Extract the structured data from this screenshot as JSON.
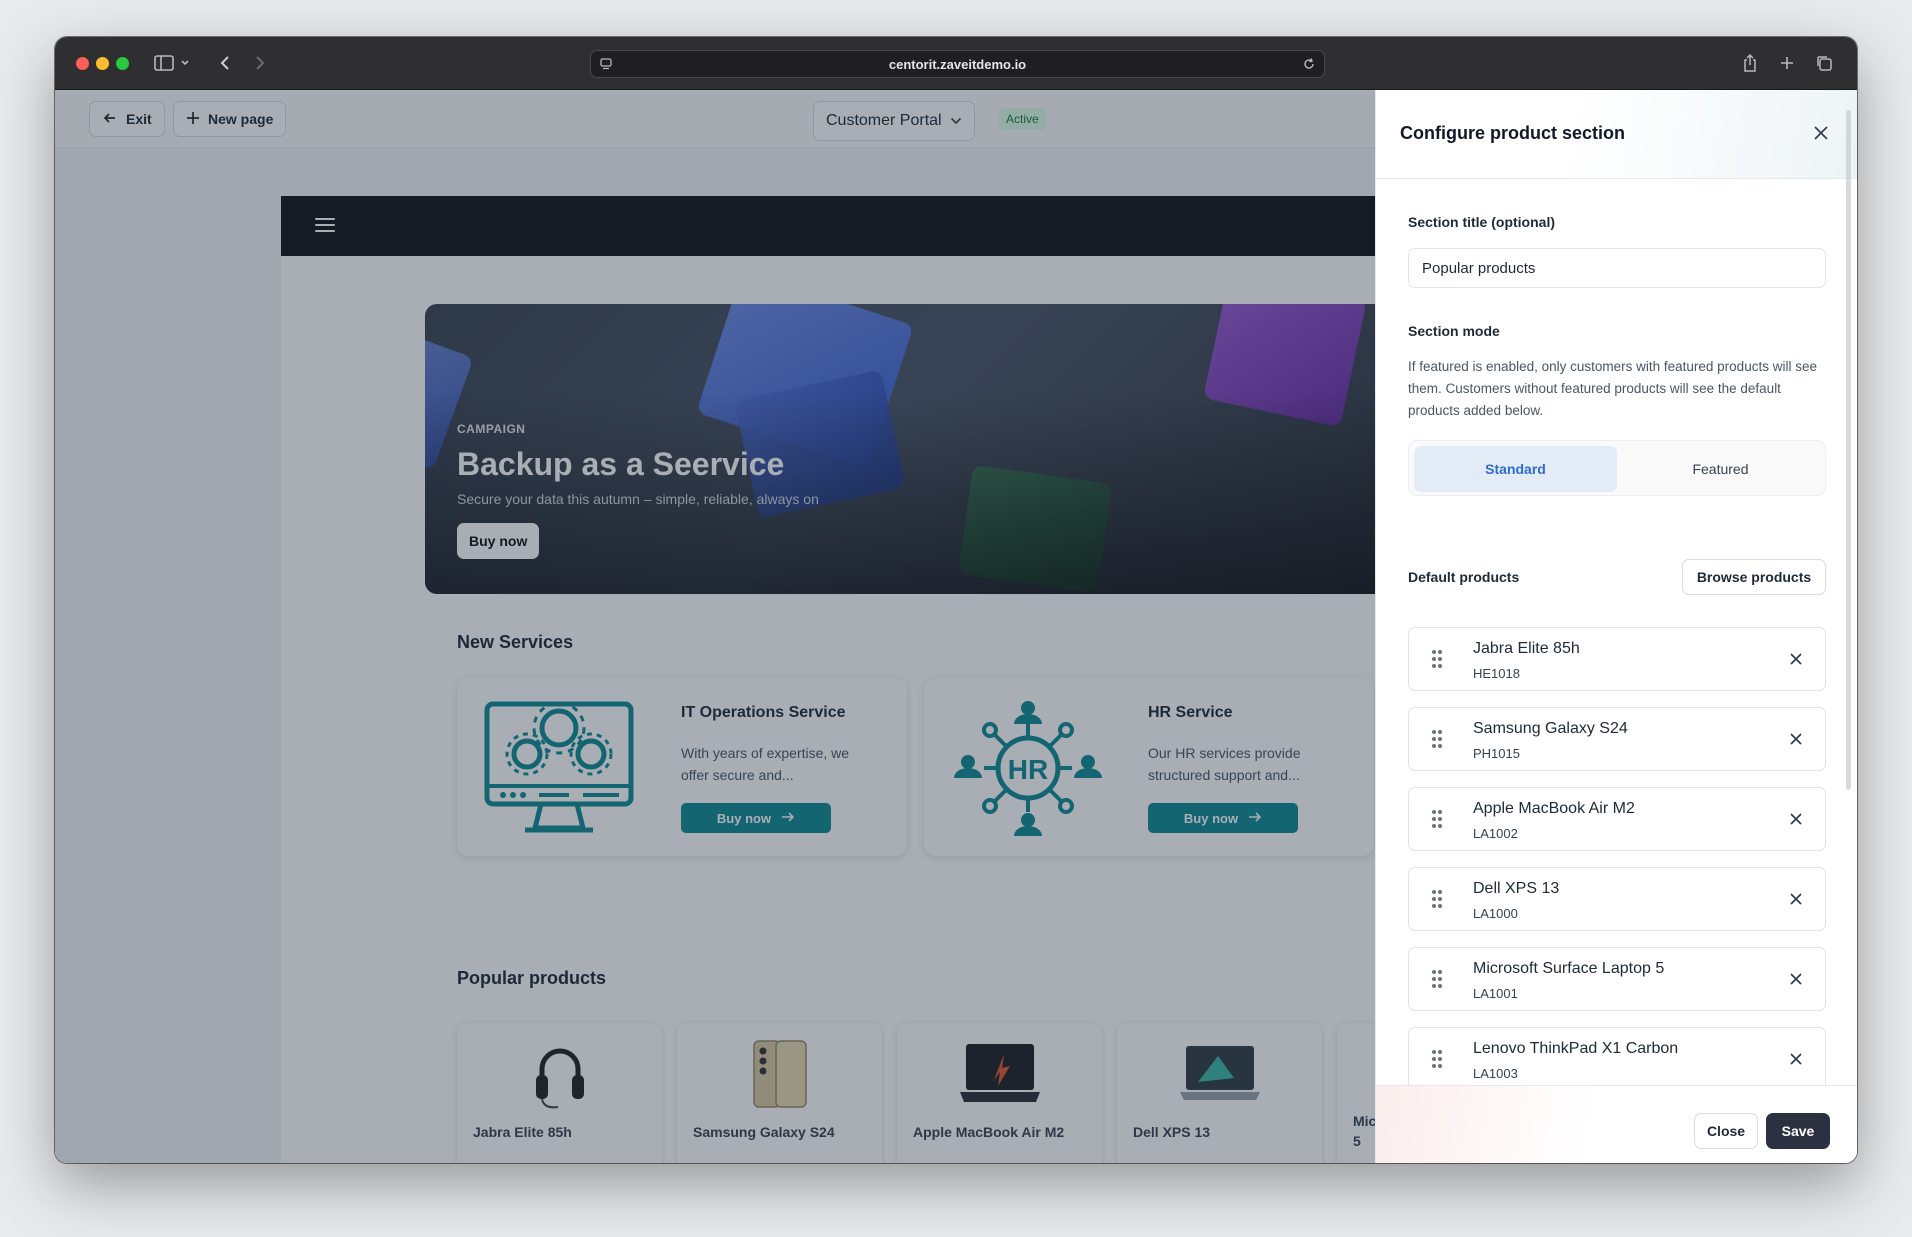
{
  "browser": {
    "url": "centorit.zaveitdemo.io"
  },
  "topbar": {
    "exit_label": "Exit",
    "new_page_label": "New page",
    "portal_name": "Customer Portal",
    "status_badge": "Active"
  },
  "hero": {
    "eyebrow": "CAMPAIGN",
    "title": "Backup as a Seervice",
    "subtitle": "Secure your data this autumn – simple, reliable, always on",
    "button_label": "Buy now"
  },
  "new_services": {
    "title": "New Services",
    "cards": [
      {
        "title": "IT Operations Service",
        "description": "With years of expertise, we offer secure and...",
        "button_label": "Buy now"
      },
      {
        "title": "HR Service",
        "description": "Our HR services provide structured support and...",
        "button_label": "Buy now"
      }
    ]
  },
  "popular_products": {
    "title": "Popular products",
    "cards": [
      {
        "name": "Jabra Elite 85h"
      },
      {
        "name": "Samsung Galaxy S24"
      },
      {
        "name": "Apple MacBook Air M2"
      },
      {
        "name": "Dell XPS 13"
      },
      {
        "name": "Mic"
      },
      {
        "name": "5"
      }
    ]
  },
  "drawer": {
    "title": "Configure product section",
    "section_title_label": "Section title (optional)",
    "section_title_value": "Popular products",
    "section_mode_label": "Section mode",
    "section_mode_description": "If featured is enabled, only customers with featured products will see them. Customers without featured products will see the default products added below.",
    "modes": [
      {
        "label": "Standard",
        "selected": true
      },
      {
        "label": "Featured",
        "selected": false
      }
    ],
    "default_products_label": "Default products",
    "browse_button_label": "Browse products",
    "products": [
      {
        "name": "Jabra Elite 85h",
        "sku": "HE1018"
      },
      {
        "name": "Samsung Galaxy S24",
        "sku": "PH1015"
      },
      {
        "name": "Apple MacBook Air M2",
        "sku": "LA1002"
      },
      {
        "name": "Dell XPS 13",
        "sku": "LA1000"
      },
      {
        "name": "Microsoft Surface Laptop 5",
        "sku": "LA1001"
      },
      {
        "name": "Lenovo ThinkPad X1 Carbon",
        "sku": "LA1003"
      }
    ],
    "close_label": "Close",
    "save_label": "Save"
  },
  "colors": {
    "accent_teal": "#0e8a95",
    "selected_mode": "#2f6bd0",
    "save_button": "#2b3140",
    "active_badge": "#15803d"
  }
}
